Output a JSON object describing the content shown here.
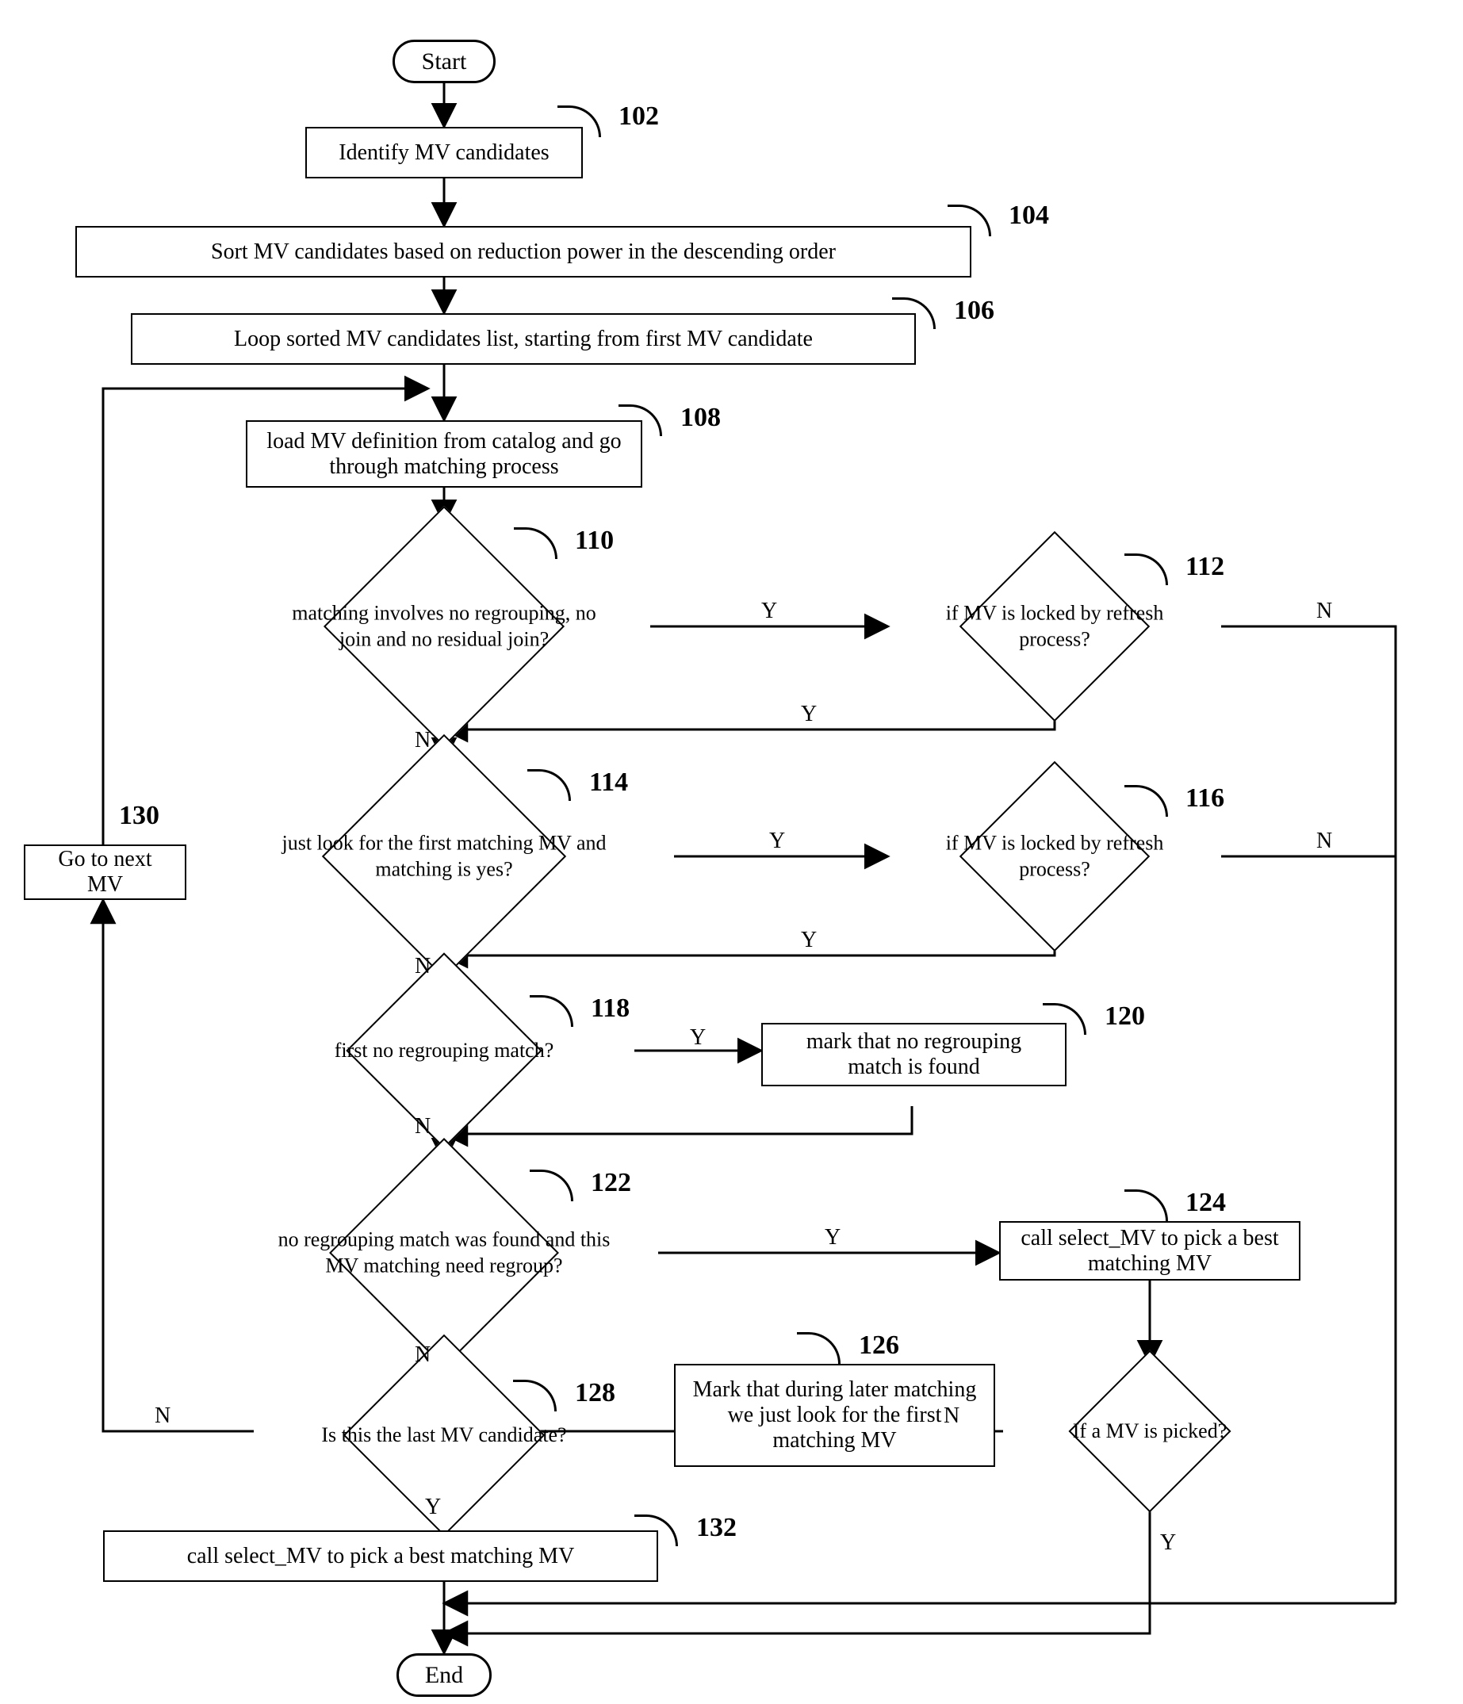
{
  "chart_data": {
    "type": "diagram",
    "title": "MV candidate matching flowchart",
    "nodes": [
      {
        "id": "start",
        "type": "terminal",
        "label": "Start",
        "ref": ""
      },
      {
        "id": "n102",
        "type": "process",
        "label": "Identify MV candidates",
        "ref": "102"
      },
      {
        "id": "n104",
        "type": "process",
        "label": "Sort MV candidates based on reduction power in the descending order",
        "ref": "104"
      },
      {
        "id": "n106",
        "type": "process",
        "label": "Loop sorted MV candidates list, starting from first MV candidate",
        "ref": "106"
      },
      {
        "id": "n108",
        "type": "process",
        "label": "load MV definition from catalog and go through matching process",
        "ref": "108"
      },
      {
        "id": "n110",
        "type": "decision",
        "label": "matching involves no regrouping, no join and no residual join?",
        "ref": "110"
      },
      {
        "id": "n112",
        "type": "decision",
        "label": "if MV is locked by refresh process?",
        "ref": "112"
      },
      {
        "id": "n114",
        "type": "decision",
        "label": "just look for the first matching MV and matching is yes?",
        "ref": "114"
      },
      {
        "id": "n116",
        "type": "decision",
        "label": "if MV is locked by refresh process?",
        "ref": "116"
      },
      {
        "id": "n118",
        "type": "decision",
        "label": "first no regrouping match?",
        "ref": "118"
      },
      {
        "id": "n120",
        "type": "process",
        "label": "mark that no regrouping match is found",
        "ref": "120"
      },
      {
        "id": "n122",
        "type": "decision",
        "label": "no regrouping match was found and this MV matching need regroup?",
        "ref": "122"
      },
      {
        "id": "n124",
        "type": "process",
        "label": "call select_MV to pick a best matching MV",
        "ref": "124"
      },
      {
        "id": "n124b",
        "type": "decision",
        "label": "If a MV is picked?",
        "ref": ""
      },
      {
        "id": "n126",
        "type": "process",
        "label": "Mark that during later matching we just look for the first matching MV",
        "ref": "126"
      },
      {
        "id": "n128",
        "type": "decision",
        "label": "Is this the last MV candidate?",
        "ref": "128"
      },
      {
        "id": "n130",
        "type": "process",
        "label": "Go to next MV",
        "ref": "130"
      },
      {
        "id": "n132",
        "type": "process",
        "label": "call select_MV to pick a best matching MV",
        "ref": "132"
      },
      {
        "id": "end",
        "type": "terminal",
        "label": "End",
        "ref": ""
      }
    ],
    "edges": [
      {
        "from": "start",
        "to": "n102"
      },
      {
        "from": "n102",
        "to": "n104"
      },
      {
        "from": "n104",
        "to": "n106"
      },
      {
        "from": "n106",
        "to": "n108"
      },
      {
        "from": "n108",
        "to": "n110"
      },
      {
        "from": "n110",
        "to": "n112",
        "label": "Y"
      },
      {
        "from": "n112",
        "to": "n110",
        "label": "Y"
      },
      {
        "from": "n112",
        "to": "end-right",
        "label": "N"
      },
      {
        "from": "n110",
        "to": "n114",
        "label": "N"
      },
      {
        "from": "n114",
        "to": "n116",
        "label": "Y"
      },
      {
        "from": "n116",
        "to": "n114",
        "label": "Y"
      },
      {
        "from": "n116",
        "to": "end-right",
        "label": "N"
      },
      {
        "from": "n114",
        "to": "n118",
        "label": "N"
      },
      {
        "from": "n118",
        "to": "n120",
        "label": "Y"
      },
      {
        "from": "n120",
        "to": "n118-below"
      },
      {
        "from": "n118",
        "to": "n122",
        "label": "N"
      },
      {
        "from": "n122",
        "to": "n124",
        "label": "Y"
      },
      {
        "from": "n124",
        "to": "n124b"
      },
      {
        "from": "n124b",
        "to": "n126",
        "label": "N"
      },
      {
        "from": "n124b",
        "to": "end",
        "label": "Y"
      },
      {
        "from": "n126",
        "to": "n128"
      },
      {
        "from": "n122",
        "to": "n128",
        "label": "N"
      },
      {
        "from": "n128",
        "to": "n132",
        "label": "Y"
      },
      {
        "from": "n128",
        "to": "n130",
        "label": "N"
      },
      {
        "from": "n130",
        "to": "n108(loop-back)"
      },
      {
        "from": "n132",
        "to": "end"
      }
    ],
    "edge_labels": {
      "Y": "Y",
      "N": "N"
    }
  }
}
